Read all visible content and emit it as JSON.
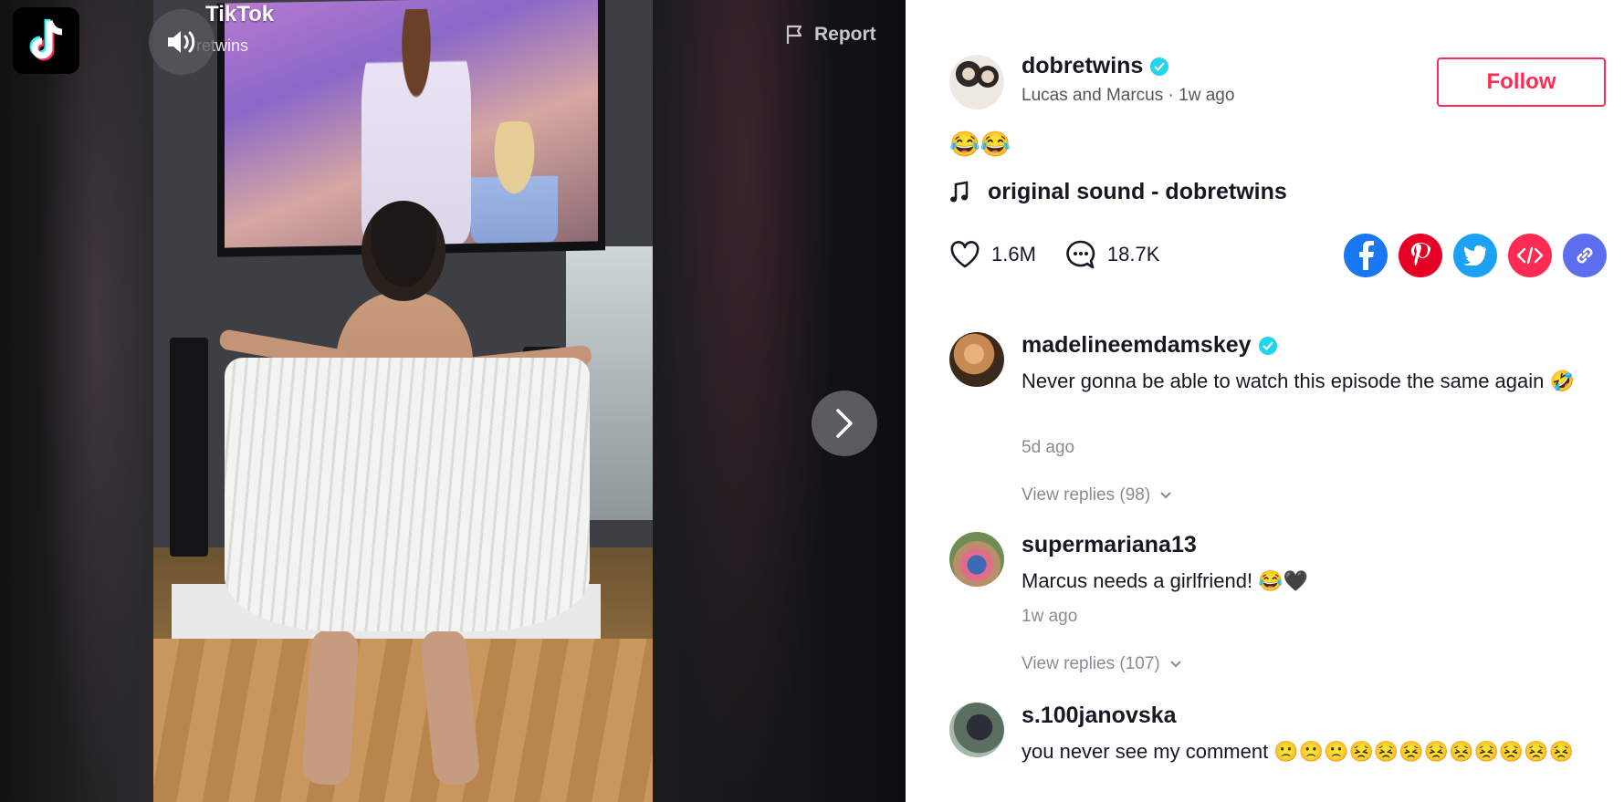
{
  "brand": {
    "watermark": "TikTok",
    "watermark_user": "retwins"
  },
  "video": {
    "report_label": "Report"
  },
  "post": {
    "username": "dobretwins",
    "display_name": "Lucas and Marcus",
    "time": "1w ago",
    "follow_label": "Follow",
    "caption": "😂😂",
    "music": "original sound - dobretwins",
    "likes": "1.6M",
    "comments": "18.7K"
  },
  "share": [
    {
      "name": "facebook",
      "color": "#1877f2"
    },
    {
      "name": "pinterest",
      "color": "#e60023"
    },
    {
      "name": "twitter",
      "color": "#1da1f2"
    },
    {
      "name": "embed",
      "color": "#fe2c55"
    },
    {
      "name": "copy-link",
      "color": "#5e6ef0"
    }
  ],
  "comments": [
    {
      "user": "madelineemdamskey",
      "verified": true,
      "text": "Never gonna be able to watch this episode the same again 🤣",
      "time": "5d ago",
      "replies": "View replies (98)"
    },
    {
      "user": "supermariana13",
      "verified": false,
      "text": "Marcus needs a girlfriend! 😂🖤",
      "time": "1w ago",
      "replies": "View replies (107)"
    },
    {
      "user": "s.100janovska",
      "verified": false,
      "text": "you never see my comment 🙁🙁🙁😣😣😣😣😣😣😣😣😣",
      "time": "",
      "replies": ""
    }
  ],
  "colors": {
    "accent": "#fe2c55",
    "verified": "#20d5ec",
    "muted": "#8a8b91"
  }
}
